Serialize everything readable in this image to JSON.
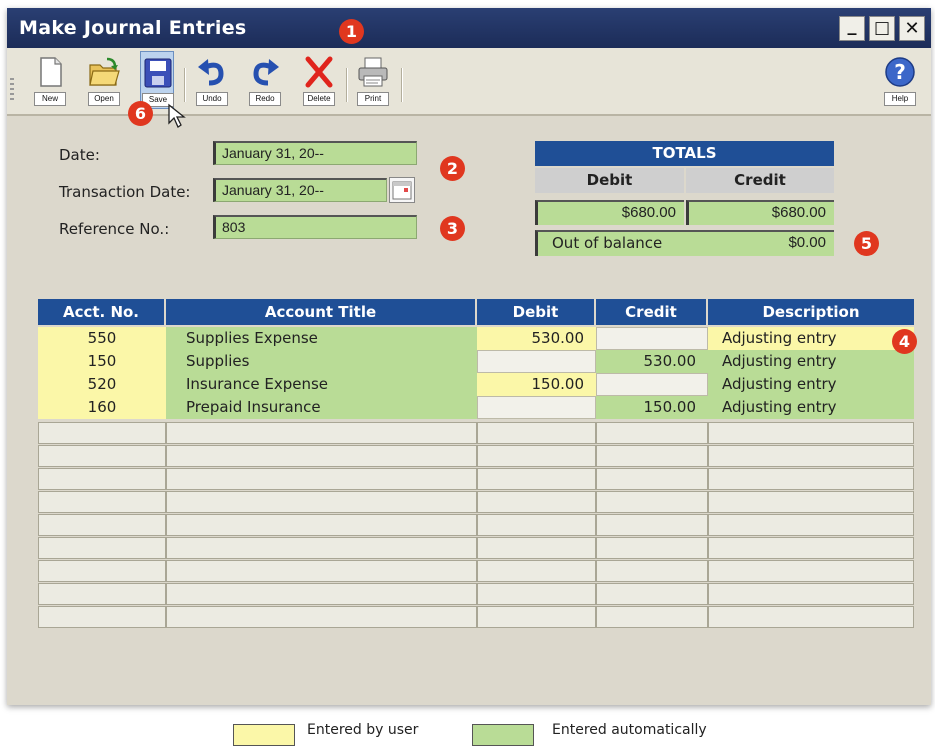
{
  "window": {
    "title": "Make Journal Entries",
    "minimize_glyph": "_",
    "maximize_glyph": "□",
    "close_glyph": "✕"
  },
  "toolbar": {
    "buttons": [
      {
        "id": "new",
        "label": "New",
        "icon": "new-document-icon"
      },
      {
        "id": "open",
        "label": "Open",
        "icon": "folder-icon"
      },
      {
        "id": "save",
        "label": "Save",
        "icon": "save-icon"
      },
      {
        "id": "undo",
        "label": "Undo",
        "icon": "undo-icon"
      },
      {
        "id": "redo",
        "label": "Redo",
        "icon": "redo-icon"
      },
      {
        "id": "delete",
        "label": "Delete",
        "icon": "delete-icon"
      },
      {
        "id": "print",
        "label": "Print",
        "icon": "print-icon"
      },
      {
        "id": "help",
        "label": "Help",
        "icon": "help-icon"
      }
    ]
  },
  "form": {
    "date_label": "Date:",
    "date_value": "January 31, 20--",
    "transaction_date_label": "Transaction Date:",
    "transaction_date_value": "January 31, 20--",
    "reference_label": "Reference No.:",
    "reference_value": "803"
  },
  "totals": {
    "title": "TOTALS",
    "debit_label": "Debit",
    "credit_label": "Credit",
    "debit_value": "$680.00",
    "credit_value": "$680.00",
    "out_of_balance_label": "Out of balance",
    "out_of_balance_value": "$0.00"
  },
  "journal": {
    "columns": [
      "Acct. No.",
      "Account Title",
      "Debit",
      "Credit",
      "Description"
    ],
    "rows": [
      {
        "acct": "550",
        "title": "Supplies Expense",
        "debit": "530.00",
        "credit": "",
        "description": "Adjusting entry"
      },
      {
        "acct": "150",
        "title": "Supplies",
        "debit": "",
        "credit": "530.00",
        "description": "Adjusting entry"
      },
      {
        "acct": "520",
        "title": "Insurance Expense",
        "debit": "150.00",
        "credit": "",
        "description": "Adjusting entry"
      },
      {
        "acct": "160",
        "title": "Prepaid Insurance",
        "debit": "",
        "credit": "150.00",
        "description": "Adjusting entry"
      }
    ],
    "empty_rows": 9
  },
  "callouts": [
    "1",
    "2",
    "3",
    "4",
    "5",
    "6"
  ],
  "legend": {
    "user_label": "Entered by user",
    "auto_label": "Entered automatically",
    "user_color": "#fbf7a8",
    "auto_color": "#b9dc96"
  },
  "colors": {
    "titlebar": "#1c2c58",
    "header_blue": "#1f4f96",
    "callout_red": "#e0371f"
  }
}
